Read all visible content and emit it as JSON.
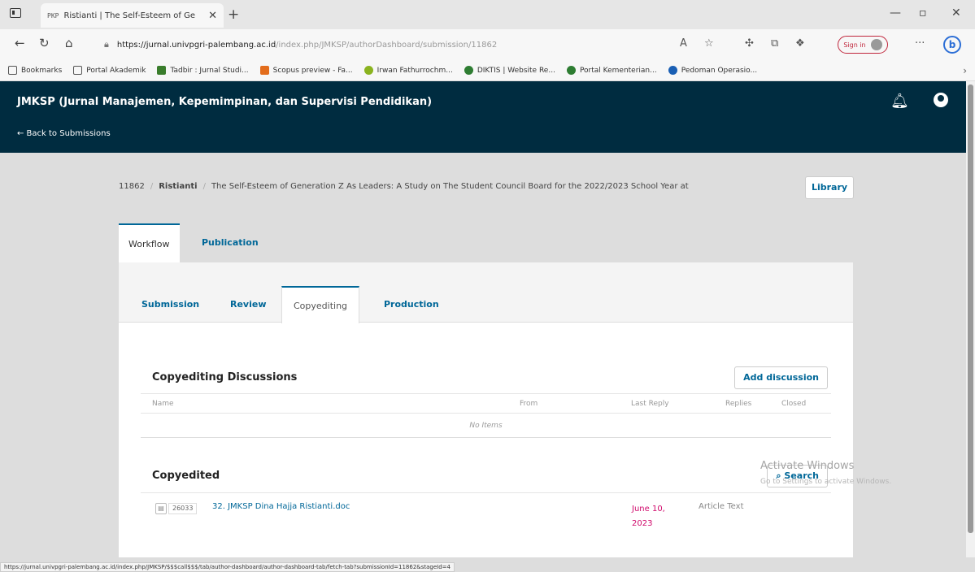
{
  "browser": {
    "tab_title": "Ristianti | The Self-Esteem of Ge",
    "tab_favicon": "PKP",
    "url_domain": "https://jurnal.univpgri-palembang.ac.id",
    "url_path": "/index.php/JMKSP/authorDashboard/submission/11862",
    "signin_label": "Sign in",
    "bookmarks": [
      {
        "label": "Bookmarks",
        "color": "#ffffff"
      },
      {
        "label": "Portal Akademik",
        "color": "#ffffff"
      },
      {
        "label": "Tadbir : Jurnal Studi...",
        "color": "#3a7d2c"
      },
      {
        "label": "Scopus preview - Fa...",
        "color": "#e36d1c"
      },
      {
        "label": "Irwan Fathurrochm...",
        "color": "#8ab31f"
      },
      {
        "label": "DIKTIS | Website Re...",
        "color": "#2e7d32"
      },
      {
        "label": "Portal Kementerian...",
        "color": "#2e7d32"
      },
      {
        "label": "Pedoman Operasio...",
        "color": "#1a5fb4"
      }
    ],
    "status_url": "https://jurnal.univpgri-palembang.ac.id/index.php/JMKSP/$$$call$$$/tab/author-dashboard/author-dashboard-tab/fetch-tab?submissionId=11862&stageId=4"
  },
  "header": {
    "journal_title": "JMKSP (Jurnal Manajemen, Kepemimpinan, dan Supervisi Pendidikan)",
    "back_link": "← Back to Submissions"
  },
  "breadcrumb": {
    "id": "11862",
    "author": "Ristianti",
    "title": "The Self-Esteem of Generation Z As Leaders: A Study on The Student Council Board for the 2022/2023 School Year at",
    "library_label": "Library"
  },
  "main_tabs": {
    "workflow": "Workflow",
    "publication": "Publication"
  },
  "stage_tabs": {
    "submission": "Submission",
    "review": "Review",
    "copyediting": "Copyediting",
    "production": "Production"
  },
  "discussions": {
    "title": "Copyediting Discussions",
    "add_label": "Add discussion",
    "columns": {
      "name": "Name",
      "from": "From",
      "last_reply": "Last Reply",
      "replies": "Replies",
      "closed": "Closed"
    },
    "empty_text": "No Items"
  },
  "copyedited": {
    "title": "Copyedited",
    "search_label": "Search",
    "files": [
      {
        "id": "26033",
        "name": "32. JMKSP Dina Hajja Ristianti.doc",
        "date": "June 10, 2023",
        "type": "Article Text"
      }
    ]
  },
  "watermark": {
    "title": "Activate Windows",
    "subtitle": "Go to Settings to activate Windows."
  }
}
